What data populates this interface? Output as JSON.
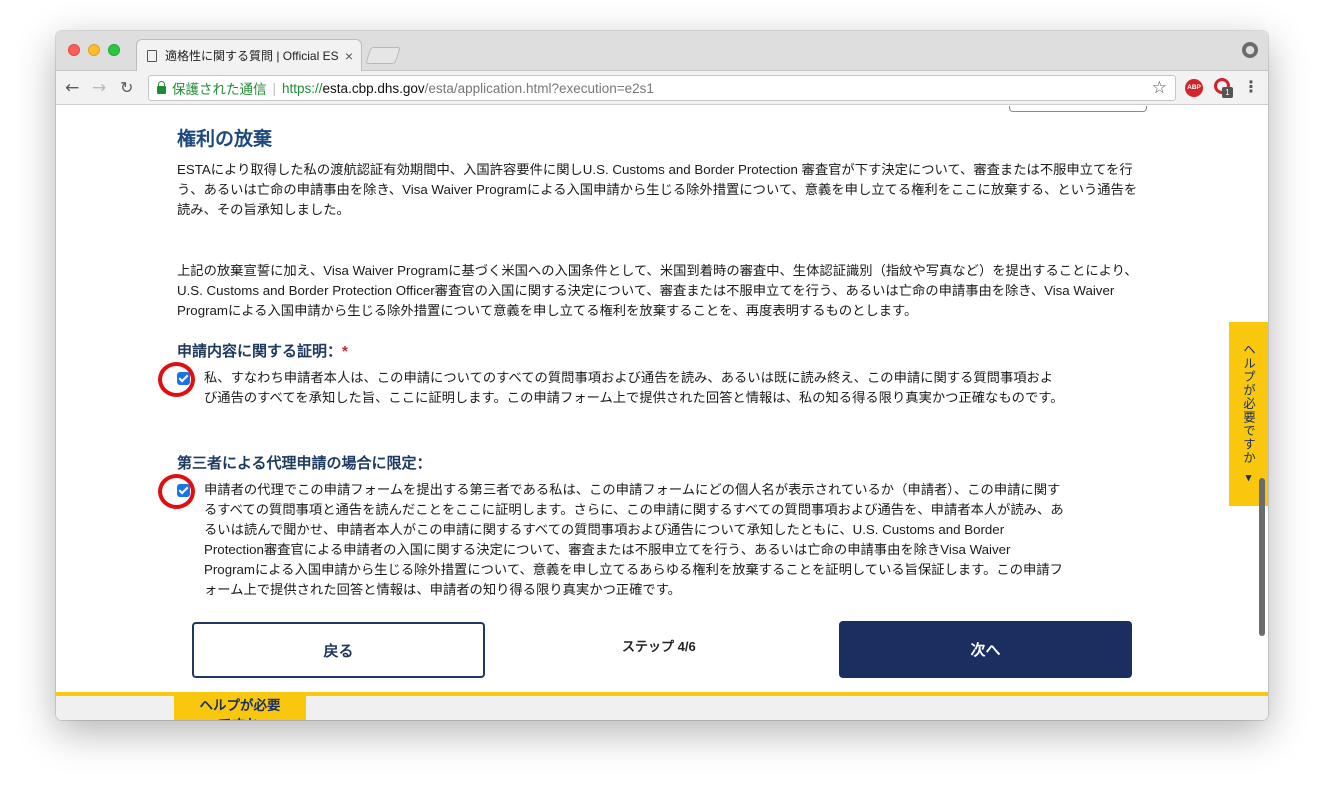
{
  "browser": {
    "tab_title": "適格性に関する質問 | Official ES",
    "tab_close": "×",
    "secure_label": "保護された通信",
    "url_scheme": "https://",
    "url_host": "esta.cbp.dhs.gov",
    "url_path": "/esta/application.html?execution=e2s1",
    "nav_back": "←",
    "nav_forward": "→",
    "nav_reload": "↻",
    "star": "☆",
    "abp_label": "ABP",
    "ext_badge": "1",
    "menu": "⋮"
  },
  "page": {
    "section_title": "権利の放棄",
    "paragraph_1": "ESTAにより取得した私の渡航認証有効期間中、入国許容要件に関しU.S. Customs and Border Protection 審査官が下す決定について、審査または不服申立てを行う、あるいは亡命の申請事由を除き、Visa Waiver Programによる入国申請から生じる除外措置について、意義を申し立てる権利をここに放棄する、という通告を読み、その旨承知しました。",
    "paragraph_2": "上記の放棄宣誓に加え、Visa Waiver Programに基づく米国への入国条件として、米国到着時の審査中、生体認証識別（指紋や写真など）を提出することにより、U.S. Customs and Border Protection Officer審査官の入国に関する決定について、審査または不服申立てを行う、あるいは亡命の申請事由を除き、Visa Waiver Programによる入国申請から生じる除外措置について意義を申し立てる権利を放棄することを、再度表明するものとします。",
    "certification_title": "申請内容に関する証明：",
    "required_mark": "*",
    "certification_text": "私、すなわち申請者本人は、この申請についてのすべての質問事項および通告を読み、あるいは既に読み終え、この申請に関する質問事項および通告のすべてを承知した旨、ここに証明します。この申請フォーム上で提供された回答と情報は、私の知る得る限り真実かつ正確なものです。",
    "third_party_title": "第三者による代理申請の場合に限定：",
    "third_party_text": "申請者の代理でこの申請フォームを提出する第三者である私は、この申請フォームにどの個人名が表示されているか（申請者）、この申請に関するすべての質問事項と通告を読んだことをここに証明します。さらに、この申請に関するすべての質問事項および通告を、申請者本人が読み、あるいは読んで聞かせ、申請者本人がこの申請に関するすべての質問事項および通告について承知したともに、U.S. Customs and Border Protection審査官による申請者の入国に関する決定について、審査または不服申立てを行う、あるいは亡命の申請事由を除きVisa Waiver Programによる入国申請から生じる除外措置について、意義を申し立てるあらゆる権利を放棄することを証明している旨保証します。この申請フォーム上で提供された回答と情報は、申請者の知り得る限り真実かつ正確です。",
    "certification_checked": true,
    "third_party_checked": true,
    "back_button": "戻る",
    "step_label": "ステップ 4/6",
    "next_button": "次へ",
    "help_box": "ヘルプが必要\nですか.",
    "help_tab": "ヘルプが必要ですか ▾"
  },
  "colors": {
    "accent_yellow": "#f9c80e",
    "navy": "#1a2f5f",
    "title_blue": "#1d4a7a",
    "annotation_red": "#e10e0e"
  }
}
